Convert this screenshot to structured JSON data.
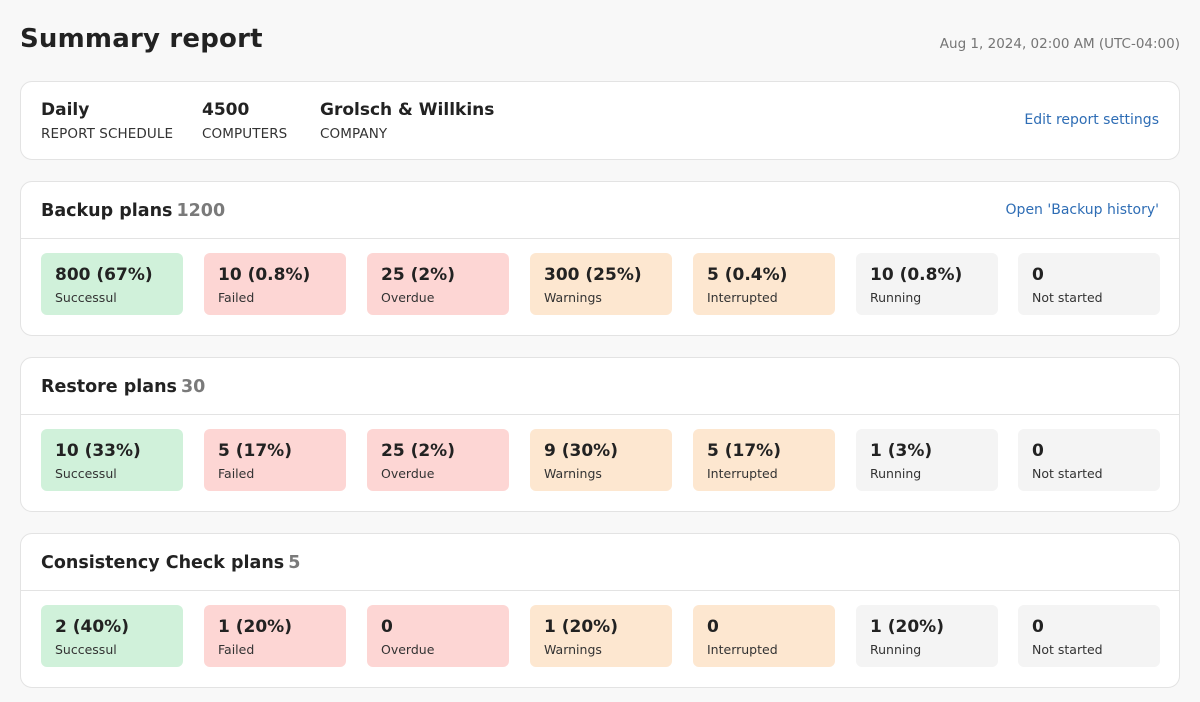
{
  "header": {
    "title": "Summary report",
    "timestamp": "Aug 1, 2024, 02:00 AM (UTC-04:00)"
  },
  "info": {
    "items": [
      {
        "value": "Daily",
        "label": "REPORT SCHEDULE"
      },
      {
        "value": "4500",
        "label": "COMPUTERS"
      },
      {
        "value": "Grolsch & Willkins",
        "label": "COMPANY"
      }
    ],
    "edit_link": "Edit report settings"
  },
  "status_colors": {
    "success": "#d0f1da",
    "failed": "#fdd6d4",
    "overdue": "#fdd6d4",
    "warning": "#fde7d0",
    "interrupted": "#fde7d0",
    "running": "#f4f4f4",
    "not_started": "#f4f4f4",
    "link": "#2e6db5"
  },
  "plans": [
    {
      "title": "Backup plans",
      "count": "1200",
      "link": "Open 'Backup history'",
      "tiles": [
        {
          "value": "800 (67%)",
          "label": "Successul",
          "status": "success"
        },
        {
          "value": "10 (0.8%)",
          "label": "Failed",
          "status": "failed"
        },
        {
          "value": "25 (2%)",
          "label": "Overdue",
          "status": "overdue"
        },
        {
          "value": "300 (25%)",
          "label": "Warnings",
          "status": "warning"
        },
        {
          "value": "5 (0.4%)",
          "label": "Interrupted",
          "status": "interrupted"
        },
        {
          "value": "10 (0.8%)",
          "label": "Running",
          "status": "running"
        },
        {
          "value": "0",
          "label": "Not started",
          "status": "not_started"
        }
      ]
    },
    {
      "title": "Restore plans",
      "count": "30",
      "link": null,
      "tiles": [
        {
          "value": "10 (33%)",
          "label": "Successul",
          "status": "success"
        },
        {
          "value": "5 (17%)",
          "label": "Failed",
          "status": "failed"
        },
        {
          "value": "25 (2%)",
          "label": "Overdue",
          "status": "overdue"
        },
        {
          "value": "9 (30%)",
          "label": "Warnings",
          "status": "warning"
        },
        {
          "value": "5 (17%)",
          "label": "Interrupted",
          "status": "interrupted"
        },
        {
          "value": "1 (3%)",
          "label": "Running",
          "status": "running"
        },
        {
          "value": "0",
          "label": "Not started",
          "status": "not_started"
        }
      ]
    },
    {
      "title": "Consistency Check plans",
      "count": "5",
      "link": null,
      "tiles": [
        {
          "value": "2 (40%)",
          "label": "Successul",
          "status": "success"
        },
        {
          "value": "1 (20%)",
          "label": "Failed",
          "status": "failed"
        },
        {
          "value": "0",
          "label": "Overdue",
          "status": "overdue"
        },
        {
          "value": "1 (20%)",
          "label": "Warnings",
          "status": "warning"
        },
        {
          "value": "0",
          "label": "Interrupted",
          "status": "interrupted"
        },
        {
          "value": "1 (20%)",
          "label": "Running",
          "status": "running"
        },
        {
          "value": "0",
          "label": "Not started",
          "status": "not_started"
        }
      ]
    }
  ]
}
